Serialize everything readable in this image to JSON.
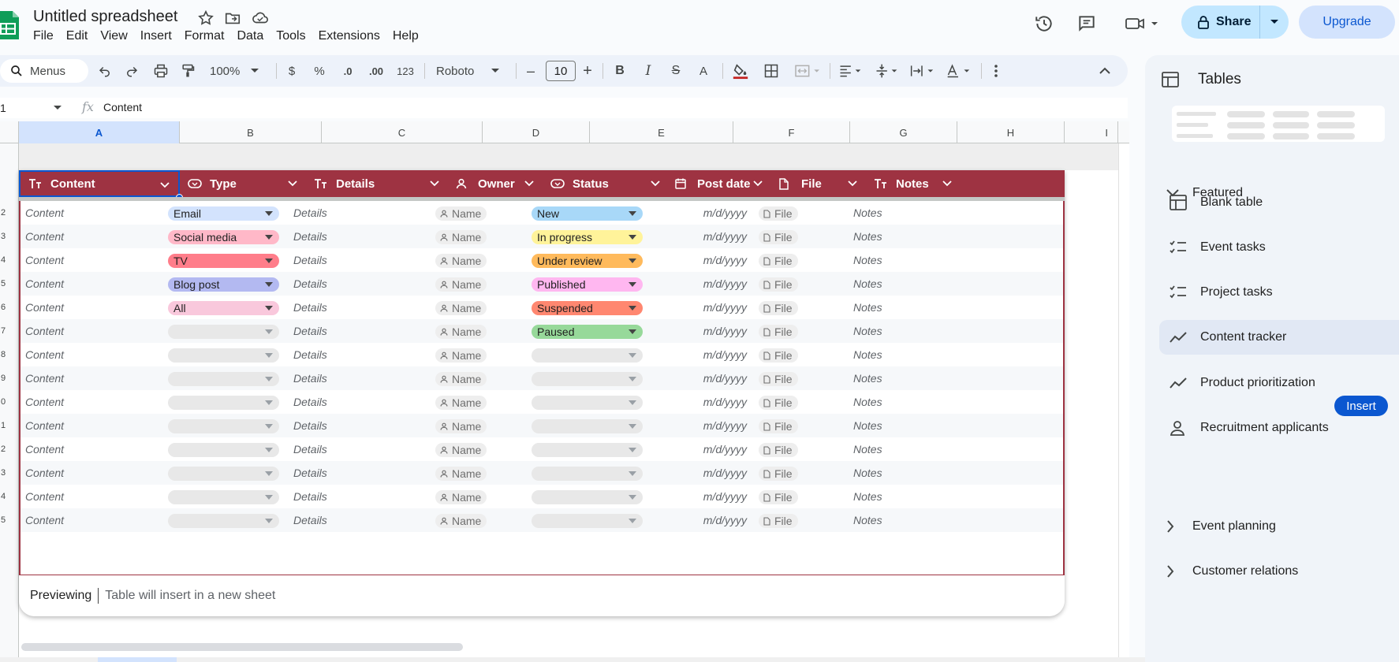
{
  "doc": {
    "title": "Untitled spreadsheet"
  },
  "menu": [
    "File",
    "Edit",
    "View",
    "Insert",
    "Format",
    "Data",
    "Tools",
    "Extensions",
    "Help"
  ],
  "header": {
    "share_label": "Share",
    "upgrade_label": "Upgrade"
  },
  "toolbar": {
    "menus_label": "Menus",
    "zoom": "100%",
    "currency": "$",
    "percent": "%",
    "dec_decrease": ".0",
    "dec_increase": ".00",
    "number_format": "123",
    "font": "Roboto",
    "font_size": "10",
    "minus": "–",
    "plus": "+",
    "bold": "B",
    "italic": "I",
    "strike": "S",
    "text_color": "A"
  },
  "formula": {
    "cell_ref": "1",
    "fx": "fx",
    "content": "Content"
  },
  "columns": [
    "A",
    "B",
    "C",
    "D",
    "E",
    "F",
    "G",
    "H",
    "I"
  ],
  "row_numbers": [
    "",
    "",
    "2",
    "3",
    "4",
    "5",
    "6",
    "7",
    "8",
    "9",
    "0",
    "1",
    "2",
    "3",
    "4",
    "5"
  ],
  "table": {
    "headers": [
      "Content",
      "Type",
      "Details",
      "Owner",
      "Status",
      "Post date",
      "File",
      "Notes"
    ],
    "placeholders": {
      "content": "Content",
      "details": "Details",
      "owner": "Name",
      "date": "m/d/yyyy",
      "file": "File",
      "notes": "Notes"
    },
    "type_chips": [
      {
        "label": "Email",
        "color": "#d3e3fd"
      },
      {
        "label": "Social media",
        "color": "#ffb8c8"
      },
      {
        "label": "TV",
        "color": "#ff7d8a"
      },
      {
        "label": "Blog post",
        "color": "#b3b9f1"
      },
      {
        "label": "All",
        "color": "#f9c8dc"
      }
    ],
    "status_chips": [
      {
        "label": "New",
        "color": "#a8d8f8"
      },
      {
        "label": "In progress",
        "color": "#fff39a"
      },
      {
        "label": "Under review",
        "color": "#ffba5c"
      },
      {
        "label": "Published",
        "color": "#ffb7f0"
      },
      {
        "label": "Suspended",
        "color": "#ff8770"
      },
      {
        "label": "Paused",
        "color": "#97d99a"
      }
    ],
    "row_count": 14,
    "header_color": "#9e3342"
  },
  "preview": {
    "label": "Previewing",
    "message": "Table will insert in a new sheet"
  },
  "side_panel": {
    "title": "Tables",
    "featured_label": "Featured",
    "templates": [
      {
        "label": "Blank table",
        "icon": "table-icon"
      },
      {
        "label": "Event tasks",
        "icon": "checklist-icon"
      },
      {
        "label": "Project tasks",
        "icon": "checklist-icon"
      },
      {
        "label": "Content tracker",
        "icon": "trend-icon"
      },
      {
        "label": "Product prioritization",
        "icon": "trend-icon"
      },
      {
        "label": "Recruitment applicants",
        "icon": "person-icon"
      }
    ],
    "insert_label": "Insert",
    "sections": [
      "Event planning",
      "Customer relations"
    ]
  }
}
